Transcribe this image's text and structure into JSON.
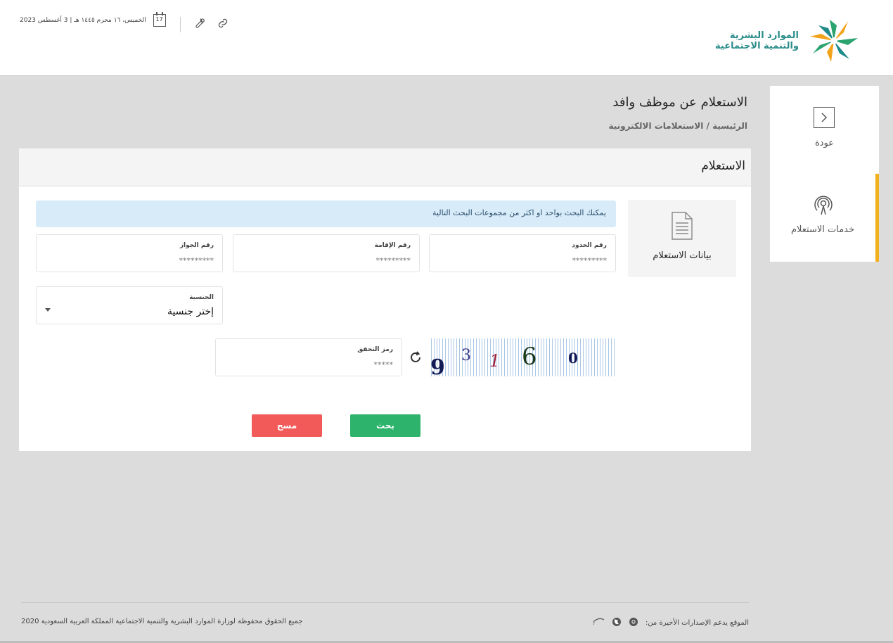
{
  "header": {
    "date_text": "الخميس، ١٦ محرم ١٤٤٥ هـ | 3 أغسطس 2023",
    "calendar_day": "17",
    "logo_line1": "الموارد البشرية",
    "logo_line2": "والتنمية الاجتماعية"
  },
  "page": {
    "title": "الاستعلام عن موظف وافد",
    "breadcrumb": "الرئيسية / الاستعلامات الالكترونية"
  },
  "sidebar": {
    "back_label": "عودة",
    "services_label": "خدمات الاستعلام",
    "accent_color": "#f2b01b"
  },
  "card": {
    "title": "الاستعلام",
    "section_label": "بيانات الاستعلام",
    "info_text": "يمكنك البحث بواحد او اكثر من مجموعات البحث التالية",
    "fields": {
      "border_number": {
        "label": "رقم الحدود",
        "placeholder": "*********"
      },
      "iqama_number": {
        "label": "رقم الإقامة",
        "placeholder": "*********"
      },
      "passport_number": {
        "label": "رقم الجواز",
        "placeholder": "*********"
      },
      "nationality": {
        "label": "الجنسية",
        "value": "إختر جنسية"
      },
      "captcha_code": {
        "label": "رمز التحقق",
        "placeholder": "*****"
      }
    },
    "captcha_chars": [
      "9",
      "3",
      "1",
      "6",
      "0"
    ],
    "search_button": "بحث",
    "clear_button": "مسح",
    "search_color": "#2db36b",
    "clear_color": "#f25a5a"
  },
  "footer": {
    "copyright": "جميع الحقوق محفوظة لوزارة الموارد البشرية والتنمية الاجتماعية المملكة العربية السعودية 2020",
    "browsers_text": "الموقع يدعم الإصدارات الأخيرة من:",
    "browsers": [
      "chrome-icon",
      "firefox-icon",
      "ie-icon"
    ]
  }
}
